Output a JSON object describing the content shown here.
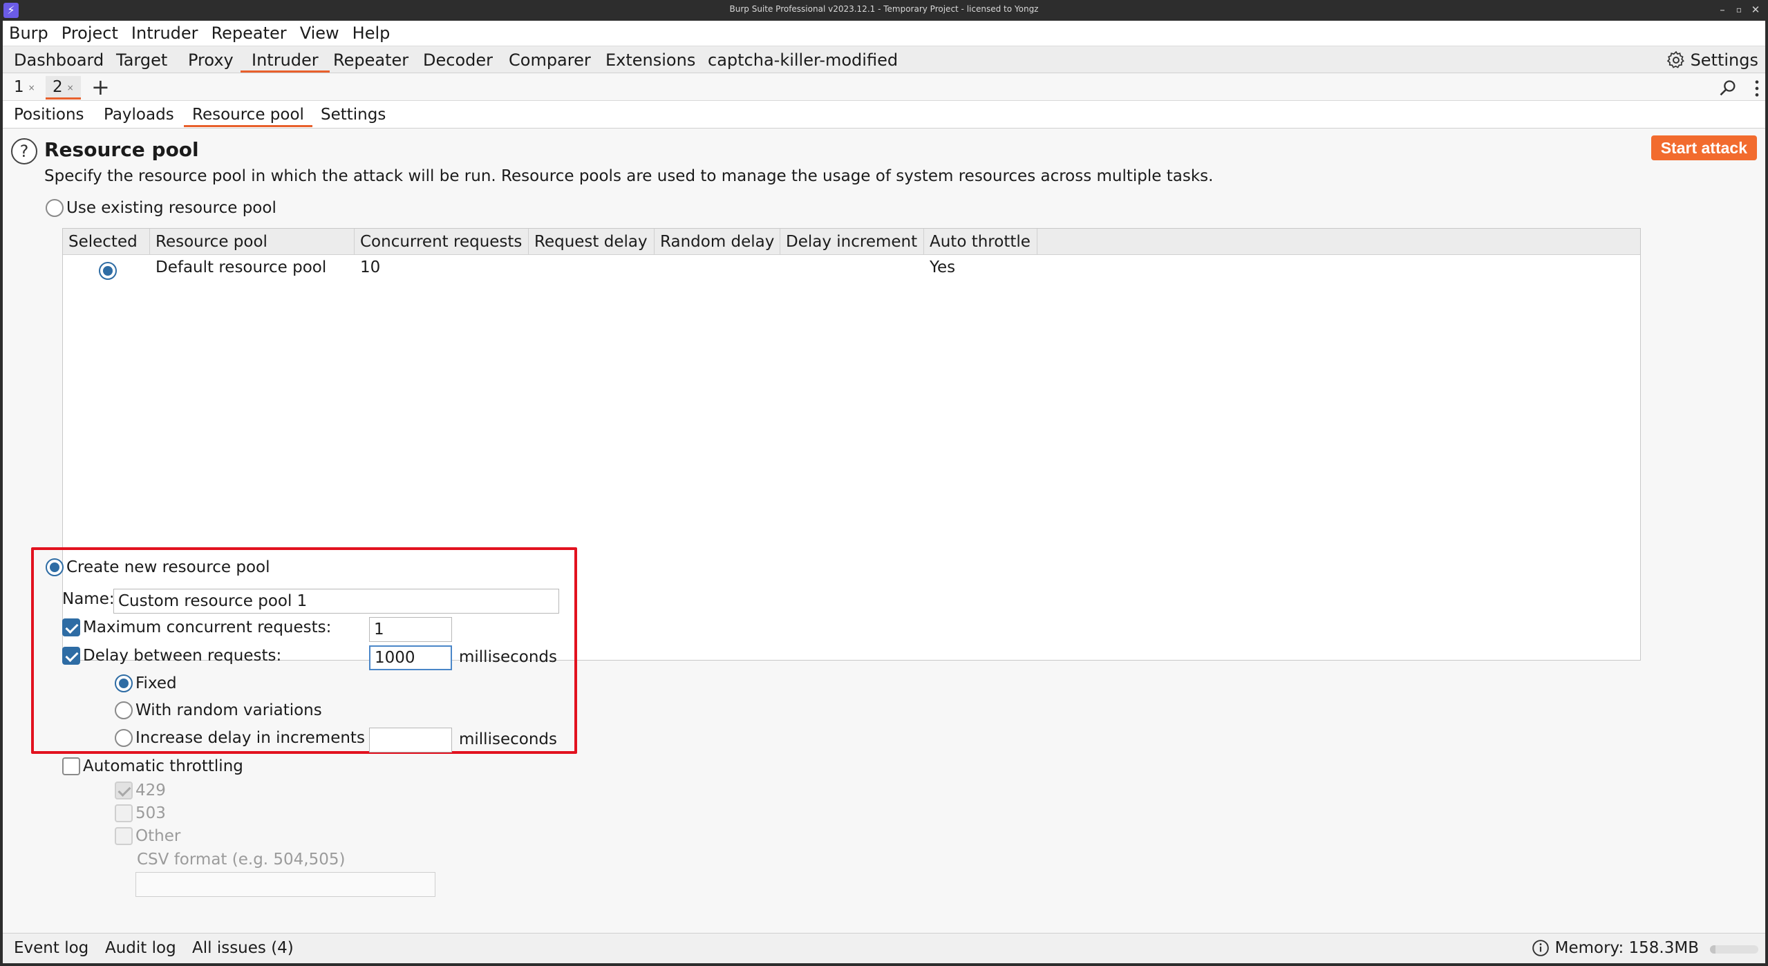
{
  "window": {
    "title": "Burp Suite Professional v2023.12.1 - Temporary Project - licensed to Yongz"
  },
  "menu": [
    "Burp",
    "Project",
    "Intruder",
    "Repeater",
    "View",
    "Help"
  ],
  "main_tabs": [
    "Dashboard",
    "Target",
    "Proxy",
    "Intruder",
    "Repeater",
    "Decoder",
    "Comparer",
    "Extensions",
    "captcha-killer-modified"
  ],
  "main_tabs_active": "Intruder",
  "settings_label": "Settings",
  "attack_tabs": [
    {
      "label": "1",
      "close": "×"
    },
    {
      "label": "2",
      "close": "×"
    }
  ],
  "add_tab_label": "+",
  "config_tabs": [
    "Positions",
    "Payloads",
    "Resource pool",
    "Settings"
  ],
  "config_tabs_active": "Resource pool",
  "section": {
    "title": "Resource pool",
    "description": "Specify the resource pool in which the attack will be run. Resource pools are used to manage the usage of system resources across multiple tasks.",
    "start_attack": "Start attack"
  },
  "existing_pool": {
    "label": "Use existing resource pool",
    "selected": false,
    "columns": [
      "Selected",
      "Resource pool",
      "Concurrent requests",
      "Request delay",
      "Random delay",
      "Delay increment",
      "Auto throttle"
    ],
    "rows": [
      {
        "selected": true,
        "name": "Default resource pool",
        "concurrent": "10",
        "request_delay": "",
        "random_delay": "",
        "delay_increment": "",
        "auto_throttle": "Yes"
      }
    ]
  },
  "new_pool": {
    "label": "Create new resource pool",
    "selected": true,
    "name_label": "Name:",
    "name_value": "Custom resource pool 1",
    "max_concurrent_label": "Maximum concurrent requests:",
    "max_concurrent_checked": true,
    "max_concurrent_value": "1",
    "delay_label": "Delay between requests:",
    "delay_checked": true,
    "delay_value": "1000",
    "delay_unit": "milliseconds",
    "fixed_label": "Fixed",
    "fixed_selected": true,
    "random_label": "With random variations",
    "increment_label": "Increase delay in increments of",
    "increment_value": "",
    "increment_unit": "milliseconds"
  },
  "throttling": {
    "label": "Automatic throttling",
    "checked": false,
    "code_429": "429",
    "code_429_checked": true,
    "code_503": "503",
    "code_other": "Other",
    "csv_label": "CSV format (e.g. 504,505)",
    "csv_value": ""
  },
  "status_bar": {
    "event_log": "Event log",
    "audit_log": "Audit log",
    "all_issues": "All issues (4)",
    "memory": "Memory: 158.3MB",
    "memory_fraction": 0.12
  },
  "colors": {
    "accent": "#e8602c",
    "start_attack": "#f26b2e",
    "highlight": "#e2121f",
    "radio_blue": "#2e6ca4"
  }
}
